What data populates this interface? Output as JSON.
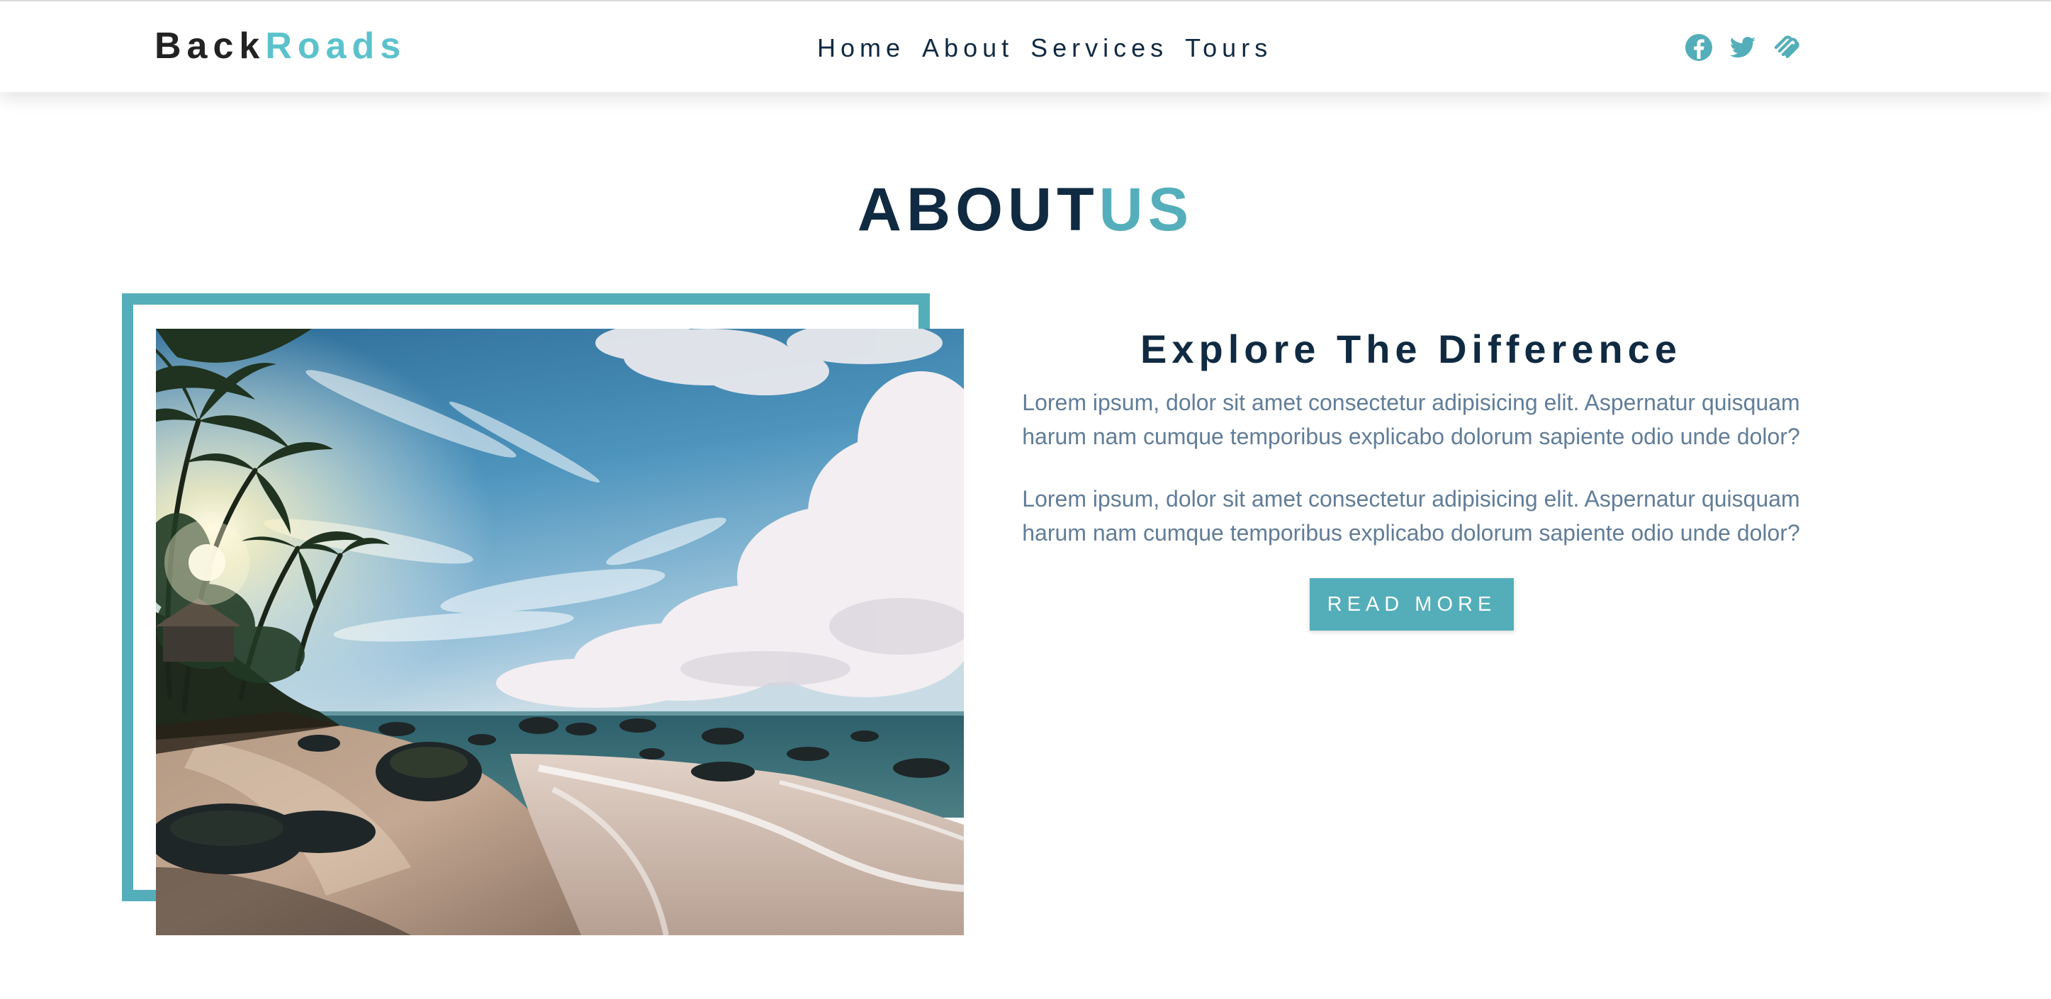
{
  "brand": {
    "part1": "Back",
    "part2": "Roads",
    "accent_color": "#5bc2cc",
    "text_color": "#222222"
  },
  "nav": {
    "links": [
      "Home",
      "About",
      "Services",
      "Tours"
    ]
  },
  "social": {
    "icons": [
      "facebook-icon",
      "twitter-icon",
      "squarespace-icon"
    ],
    "color": "#53aeb9"
  },
  "about": {
    "title_part1": "ABOUT",
    "title_part2": "US",
    "heading": "Explore The Difference",
    "paragraph1": "Lorem ipsum, dolor sit amet consectetur adipisicing elit. Aspernatur quisquam harum nam cumque temporibus explicabo dolorum sapiente odio unde dolor?",
    "paragraph2": "Lorem ipsum, dolor sit amet consectetur adipisicing elit. Aspernatur quisquam harum nam cumque temporibus explicabo dolorum sapiente odio unde dolor?",
    "button_label": "READ MORE"
  },
  "colors": {
    "primary": "#53aeb9",
    "heading": "#102a42",
    "body_text": "#617d98"
  }
}
